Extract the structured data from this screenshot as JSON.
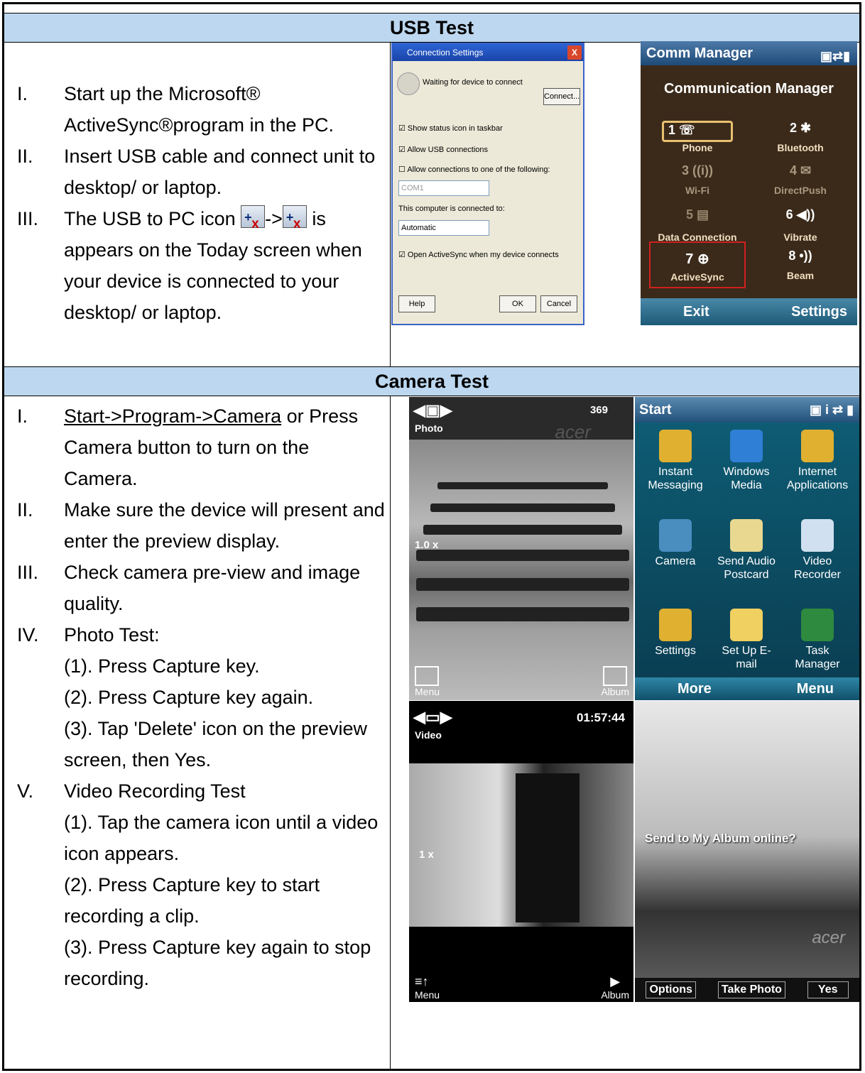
{
  "usb": {
    "header": "USB Test",
    "steps": [
      {
        "num": "I.",
        "text": "Start up the Microsoft® ActiveSync®program in the PC."
      },
      {
        "num": "II.",
        "text": "Insert USB cable and connect unit to desktop/ or laptop."
      },
      {
        "num": "III.",
        "text_a": "The USB to PC icon",
        "text_b": "->",
        "text_c": "is appears on the Today screen when your device is connected to your desktop/ or laptop."
      }
    ],
    "dialog": {
      "title": "Connection Settings",
      "waiting": "Waiting for device to connect",
      "connect_btn": "Connect...",
      "opt1": "Show status icon in taskbar",
      "opt2": "Allow USB connections",
      "opt3": "Allow connections to one of the following:",
      "com_value": "COM1",
      "connected_to": "This computer is connected to:",
      "connected_value": "Automatic",
      "opt4": "Open ActiveSync when my device connects",
      "help": "Help",
      "ok": "OK",
      "cancel": "Cancel"
    },
    "comm": {
      "title": "Comm Manager",
      "heading": "Communication Manager",
      "items": [
        {
          "n": "1",
          "label": "Phone"
        },
        {
          "n": "2",
          "label": "Bluetooth"
        },
        {
          "n": "3",
          "label": "Wi-Fi"
        },
        {
          "n": "4",
          "label": "DirectPush"
        },
        {
          "n": "5",
          "label": "Data Connection"
        },
        {
          "n": "6",
          "label": "Vibrate"
        },
        {
          "n": "7",
          "label": "ActiveSync"
        },
        {
          "n": "8",
          "label": "Beam"
        }
      ],
      "left_soft": "Exit",
      "right_soft": "Settings"
    }
  },
  "camera": {
    "header": "Camera Test",
    "steps": [
      {
        "num": "I.",
        "link": "Start->Program->Camera",
        "text": " or Press Camera button to turn on the Camera."
      },
      {
        "num": "II.",
        "text": "Make sure the device will present and enter the preview display."
      },
      {
        "num": "III.",
        "text": "Check camera pre-view and image quality."
      },
      {
        "num": "IV.",
        "text": "Photo Test:",
        "subs": [
          "(1). Press Capture key.",
          "(2). Press Capture key again.",
          "(3). Tap 'Delete' icon on the preview screen, then Yes."
        ]
      },
      {
        "num": "V.",
        "text": "Video Recording Test",
        "subs": [
          "(1). Tap the camera icon until a video icon appears.",
          "(2). Press Capture key to start recording a clip.",
          "(3). Press Capture key again to stop recording."
        ]
      }
    ],
    "photo_screen": {
      "mode": "Photo",
      "count": "369",
      "zoom": "1.0 x",
      "left": "Menu",
      "right": "Album",
      "brand": "acer"
    },
    "start_screen": {
      "title": "Start",
      "apps": [
        {
          "label": "Instant Messaging",
          "icon": "messaging-icon",
          "color": "#e0b030"
        },
        {
          "label": "Windows Media",
          "icon": "media-icon",
          "color": "#2f7fd6"
        },
        {
          "label": "Internet Applications",
          "icon": "globe-icon",
          "color": "#e0b030"
        },
        {
          "label": "Camera",
          "icon": "camera-icon",
          "color": "#4a8ec0"
        },
        {
          "label": "Send Audio Postcard",
          "icon": "postcard-icon",
          "color": "#e8d890"
        },
        {
          "label": "Video Recorder",
          "icon": "video-recorder-icon",
          "color": "#d0e0f0"
        },
        {
          "label": "Settings",
          "icon": "settings-icon",
          "color": "#e0b030"
        },
        {
          "label": "Set Up E-mail",
          "icon": "email-icon",
          "color": "#f0d060"
        },
        {
          "label": "Task Manager",
          "icon": "task-manager-icon",
          "color": "#2e8a3e"
        }
      ],
      "left_soft": "More",
      "right_soft": "Menu"
    },
    "video_screen": {
      "mode": "Video",
      "time": "01:57:44",
      "zoom": "1 x",
      "left": "Menu",
      "right": "Album"
    },
    "album_screen": {
      "prompt": "Send to My Album online?",
      "buttons": [
        "Options",
        "Take Photo",
        "Yes"
      ],
      "brand": "acer"
    }
  }
}
